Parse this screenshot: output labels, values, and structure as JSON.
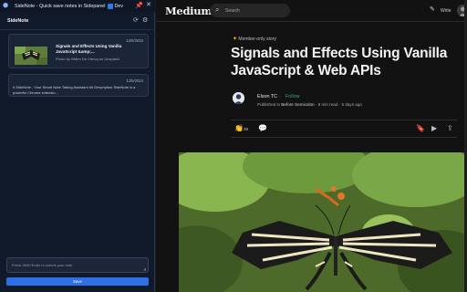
{
  "extension_bar": {
    "title": "SideNote - Quick save notes in Sidepanel",
    "dev_label": "Dev",
    "icons": {
      "app": "sidenote-app-icon",
      "badge": "dev-badge-icon",
      "pin": "pin-icon",
      "close": "close-icon"
    }
  },
  "sidenote": {
    "header_title": "SideNote",
    "icons": {
      "refresh": "refresh-icon",
      "settings": "gear-icon"
    },
    "notes": [
      {
        "date": "12/5/2024",
        "title": "Signals and Effects Using Vanilla JavaScript &amp;...",
        "credit": "Photo by Willen De Clercq on Unsplash"
      },
      {
        "date": "12/5/2024",
        "text": "# SideNote - Your Smart Note-Taking Assistant ## Description SideNote is a powerful Chrome extensio..."
      }
    ],
    "compose_placeholder": "Press Shift+Enter to submit your note.",
    "save_label": "Save"
  },
  "medium": {
    "logo": "Medium",
    "search_placeholder": "Search",
    "write_label": "Write",
    "members_label": "Member-only story",
    "headline": "Signals and Effects Using Vanilla JavaScript & Web APIs",
    "author": "Elson TC",
    "separator": "·",
    "follow_label": "Follow",
    "published_prefix": "Published in",
    "publication": "Before Semicolon",
    "read_time": "8 min read",
    "age": "6 days ago",
    "clap_count": "39",
    "icons": {
      "search": "search-icon",
      "write": "write-icon",
      "clap": "clap-icon",
      "comment": "comment-icon",
      "bookmark": "bookmark-icon",
      "play": "play-icon",
      "share": "share-icon",
      "member_star": "star-icon"
    }
  },
  "colors": {
    "panel_bg": "#111a2b",
    "save_button": "#2f6fe6",
    "follow_green": "#3fa66a",
    "member_star": "#ffc017",
    "page_bg": "#121212"
  }
}
